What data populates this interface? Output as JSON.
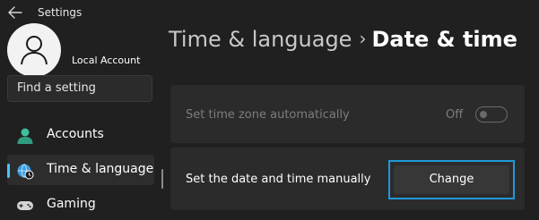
{
  "app": {
    "title": "Settings"
  },
  "account": {
    "name": "Local Account"
  },
  "search": {
    "placeholder": "Find a setting"
  },
  "sidebar": {
    "items": [
      {
        "label": "Accounts",
        "icon": "person-icon"
      },
      {
        "label": "Time & language",
        "icon": "globe-clock-icon",
        "active": true
      },
      {
        "label": "Gaming",
        "icon": "gamepad-icon"
      }
    ]
  },
  "breadcrumb": {
    "parent": "Time & language",
    "separator": "›",
    "current": "Date & time"
  },
  "settings": {
    "timezone_auto": {
      "label": "Set time zone automatically",
      "state": "Off",
      "enabled": false
    },
    "manual_date": {
      "label": "Set the date and time manually",
      "button": "Change"
    }
  },
  "colors": {
    "accent": "#4cc2ff",
    "focus_ring": "#1e9ad8",
    "background": "#202020",
    "card": "#2b2b2b"
  }
}
